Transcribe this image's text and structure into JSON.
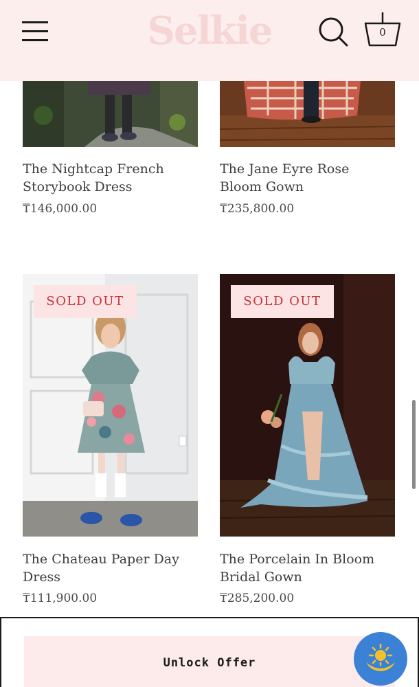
{
  "header": {
    "logo": "Selkie",
    "cart_count": "0"
  },
  "products": [
    {
      "title": "The Nightcap French Storybook Dress",
      "price": "₸146,000.00",
      "badge": ""
    },
    {
      "title": "The Jane Eyre Rose Bloom Gown",
      "price": "₸235,800.00",
      "badge": ""
    },
    {
      "title": "The Chateau Paper Day Dress",
      "price": "₸111,900.00",
      "badge": "SOLD OUT"
    },
    {
      "title": "The Porcelain In Bloom Bridal Gown",
      "price": "₸285,200.00",
      "badge": "SOLD OUT"
    }
  ],
  "offer": {
    "button_label": "Unlock Offer"
  },
  "icons": {
    "menu": "hamburger-menu-icon",
    "search": "search-icon",
    "cart": "basket-cart-icon",
    "chat": "sun-emblem-icon"
  },
  "colors": {
    "header_bg": "#fdeeee",
    "logo": "#f6d6d5",
    "badge_bg": "#fbe4e3",
    "badge_text": "#c8323a",
    "chat_button": "#3b82d6"
  }
}
